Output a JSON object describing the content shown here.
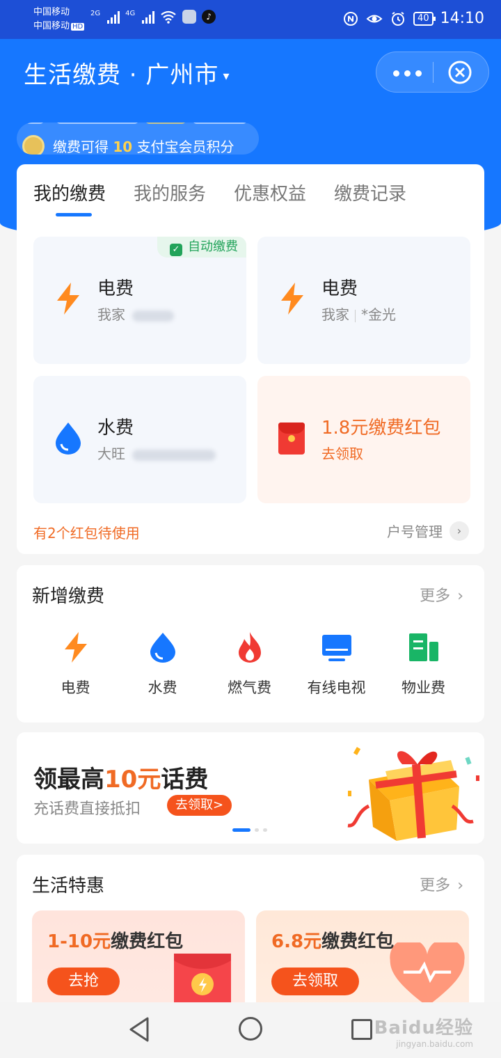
{
  "status_bar": {
    "carrier1": "中国移动",
    "carrier2": "中国移动",
    "hd": "HD",
    "net1": "2G",
    "net2": "4G",
    "battery": "40",
    "time": "14:10"
  },
  "header": {
    "title": "生活缴费 · 广州市",
    "caret": "▾"
  },
  "ticker": {
    "prefix": "缴费可得",
    "points": "10",
    "suffix": "支付宝会员积分"
  },
  "tabs": [
    {
      "label": "我的缴费"
    },
    {
      "label": "我的服务"
    },
    {
      "label": "优惠权益"
    },
    {
      "label": "缴费记录"
    }
  ],
  "bills": [
    {
      "title": "电费",
      "account": "我家",
      "badge": "自动缴费",
      "icon": "lightning-icon"
    },
    {
      "title": "电费",
      "account": "我家",
      "owner": "*金光",
      "icon": "lightning-icon"
    },
    {
      "title": "水费",
      "account": "大旺",
      "icon": "water-drop-icon"
    },
    {
      "title": "1.8元缴费红包",
      "action": "去领取",
      "icon": "red-envelope-icon"
    }
  ],
  "main_footer": {
    "left": "有2个红包待使用",
    "right": "户号管理",
    "right_chevron": "›"
  },
  "new_bills": {
    "title": "新增缴费",
    "more": "更多",
    "chevron": "›",
    "items": [
      {
        "label": "电费",
        "icon": "lightning-icon"
      },
      {
        "label": "水费",
        "icon": "water-drop-icon"
      },
      {
        "label": "燃气费",
        "icon": "flame-icon"
      },
      {
        "label": "有线电视",
        "icon": "tv-icon"
      },
      {
        "label": "物业费",
        "icon": "building-icon"
      }
    ]
  },
  "banner": {
    "title_pre": "领最高",
    "title_hl": "10元",
    "title_post": "话费",
    "subtitle": "充话费直接抵扣",
    "button": "去领取>"
  },
  "life_deals": {
    "title": "生活特惠",
    "more": "更多",
    "chevron": "›",
    "promos": [
      {
        "amount": "1-10元",
        "label": "缴费红包",
        "button": "去抢"
      },
      {
        "amount": "6.8元",
        "label": "缴费红包",
        "button": "去领取"
      }
    ]
  },
  "watermark": {
    "line1": "Baidu经验",
    "line2": "jingyan.baidu.com"
  },
  "colors": {
    "primary": "#1677ff",
    "accent_orange": "#f06a24",
    "status_bar": "#1d4fd6",
    "auto_green": "#22a35a"
  }
}
